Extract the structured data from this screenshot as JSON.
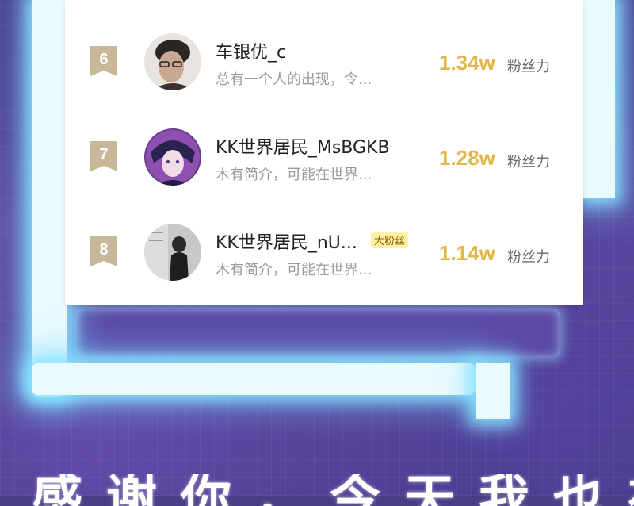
{
  "leaderboard": {
    "entries": [
      {
        "rank": "6",
        "name": "车银优_c",
        "bio": "总有一个人的出现，令...",
        "score": "1.34w",
        "score_label": "粉丝力",
        "badge": ""
      },
      {
        "rank": "7",
        "name": "KK世界居民_MsBGKB",
        "bio": "木有简介，可能在世界...",
        "score": "1.28w",
        "score_label": "粉丝力",
        "badge": ""
      },
      {
        "rank": "8",
        "name": "KK世界居民_nU...",
        "bio": "木有简介，可能在世界...",
        "score": "1.14w",
        "score_label": "粉丝力",
        "badge": "大粉丝"
      }
    ]
  },
  "banner": {
    "text": "感谢你，今天我也在这里"
  },
  "colors": {
    "score": "#e3b64a",
    "rank_badge": "#c9b79a",
    "badge_bg": "#fff1a6",
    "background": "#4a3f86",
    "neon": "#e8fbff"
  },
  "icons": [
    "rank-ribbon-icon",
    "avatar-image"
  ]
}
